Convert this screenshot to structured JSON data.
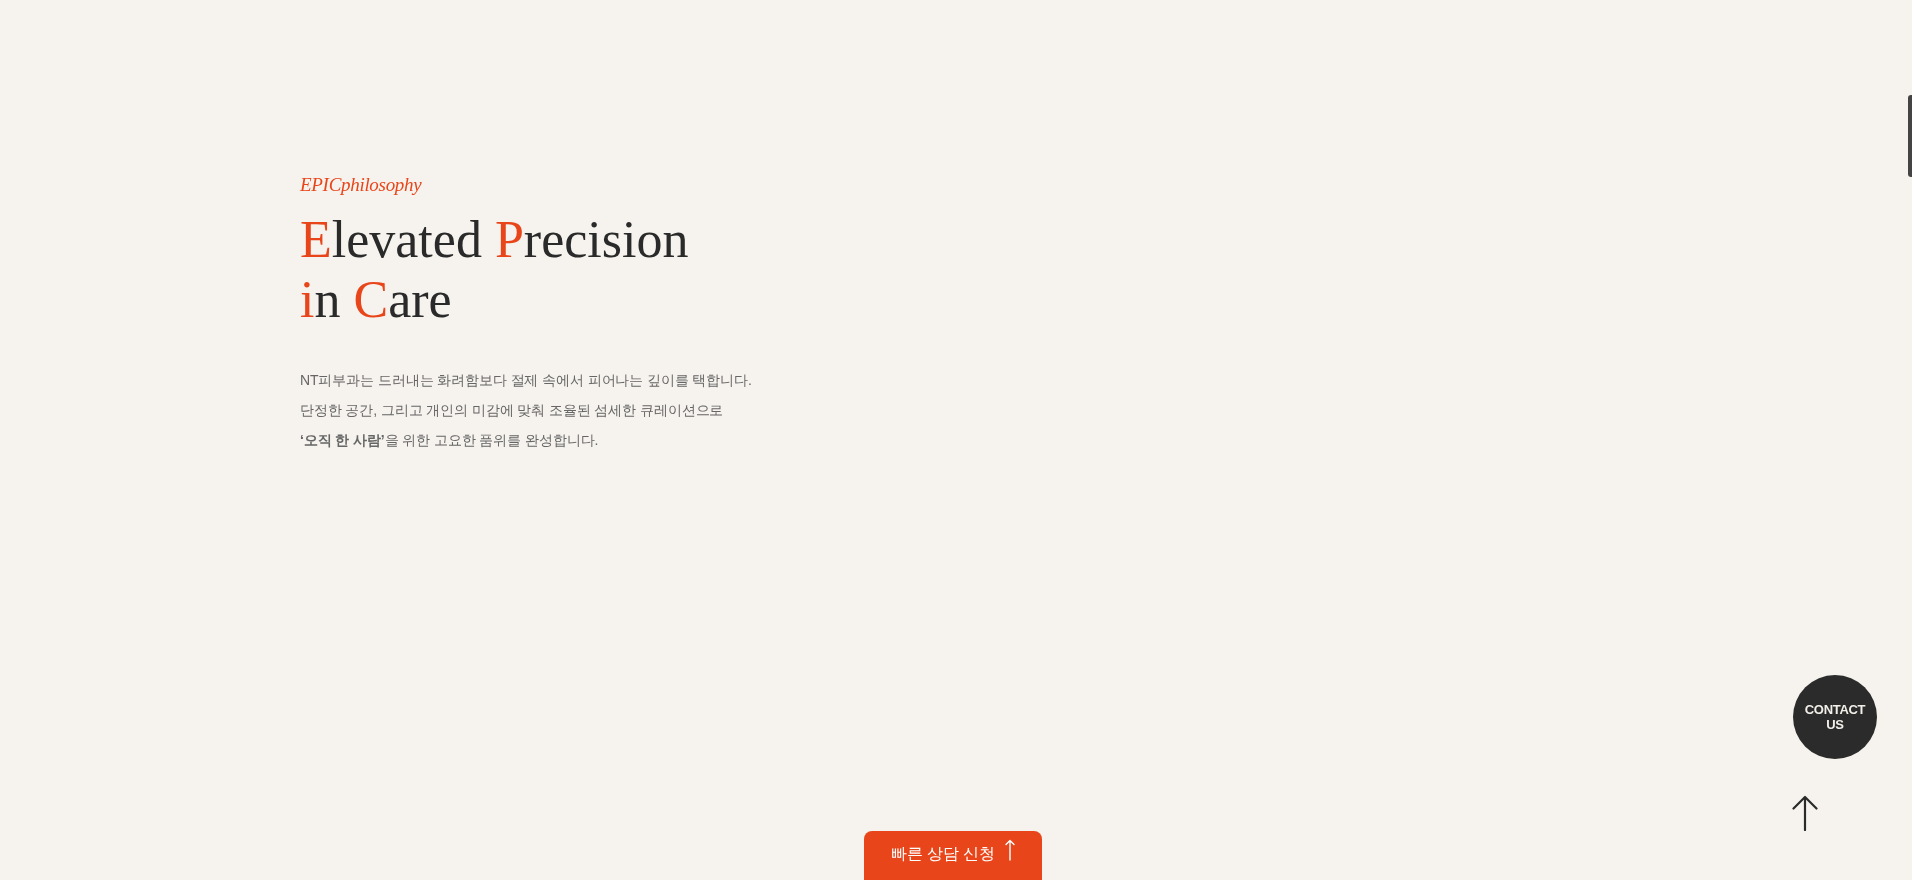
{
  "eyebrow": "EPICphilosophy",
  "heading": {
    "lines": [
      [
        {
          "text": "E",
          "accent": true
        },
        {
          "text": "levated ",
          "accent": false
        },
        {
          "text": "P",
          "accent": true
        },
        {
          "text": "recision",
          "accent": false
        }
      ],
      [
        {
          "text": "i",
          "accent": true
        },
        {
          "text": "n ",
          "accent": false
        },
        {
          "text": "C",
          "accent": true
        },
        {
          "text": "are",
          "accent": false
        }
      ]
    ]
  },
  "body": {
    "lines": [
      "NT피부과는 드러내는 화려함보다 절제 속에서 피어나는 깊이를 택합니다.",
      "단정한 공간, 그리고 개인의 미감에 맞춰 조율된 섬세한 큐레이션으로",
      "**‘오직 한 사람’**을 위한 고요한 품위를 완성합니다."
    ]
  },
  "contact_button": {
    "label": "CONTACT US"
  },
  "quick_consult_button": {
    "label": "빠른 상담 신청"
  }
}
